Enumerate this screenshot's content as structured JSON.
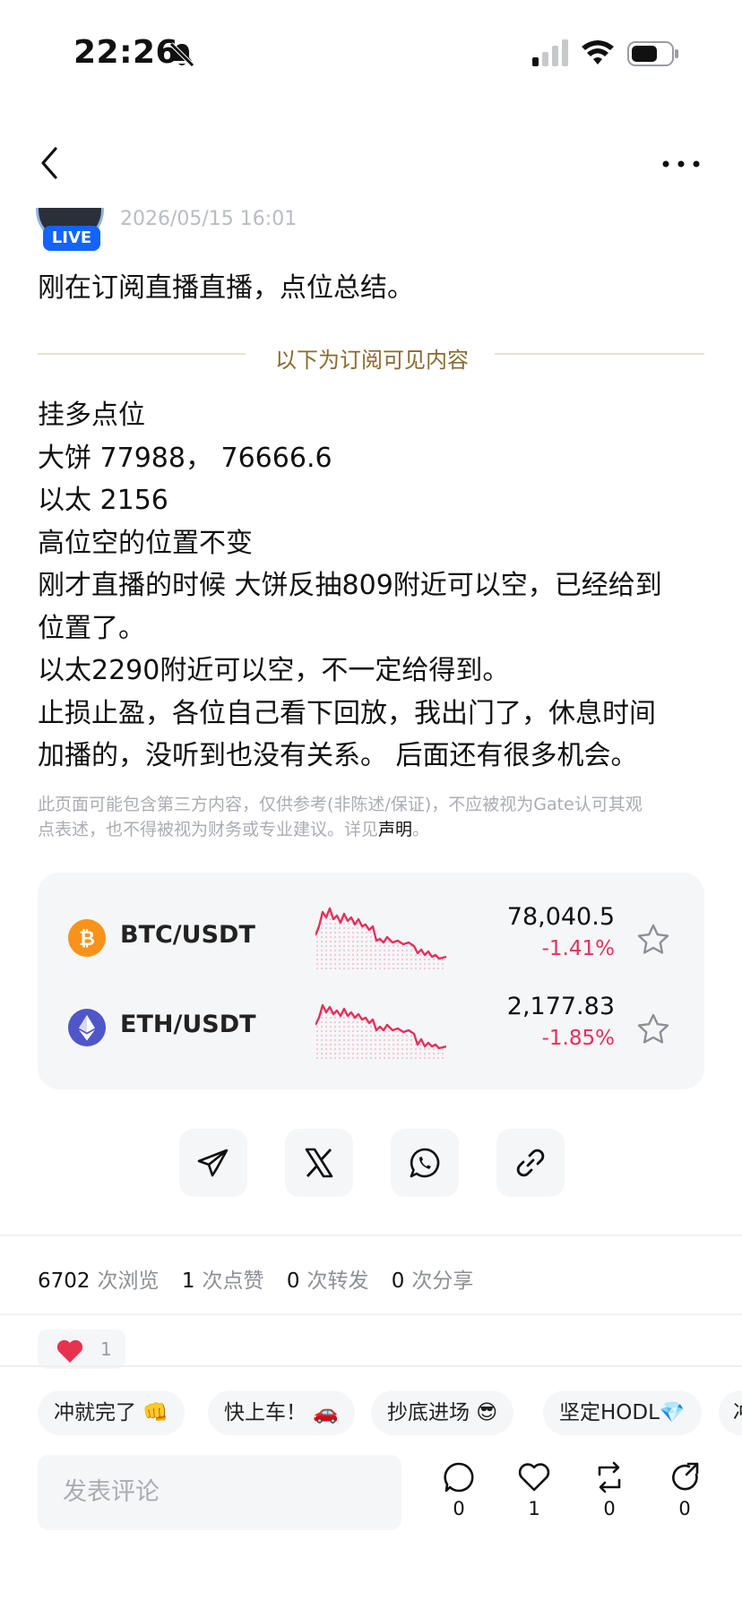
{
  "status_bar": {
    "time": "22:26"
  },
  "post": {
    "live_badge": "LIVE",
    "date": "2026/05/15 16:01",
    "title": "刚在订阅直播直播，点位总结。",
    "subscriber_divider": "以下为订阅可见内容",
    "body_lines": [
      "挂多点位",
      "大饼 77988，  76666.6",
      "以太 2156",
      "高位空的位置不变",
      "刚才直播的时候 大饼反抽809附近可以空，已经给到",
      "位置了。",
      "以太2290附近可以空，不一定给得到。",
      "止损止盈，各位自己看下回放，我出门了，休息时间",
      "加播的，没听到也没有关系。 后面还有很多机会。"
    ],
    "disclaimer_line1": "此页面可能包含第三方内容，仅供参考(非陈述/保证)，不应被视为Gate认可其观",
    "disclaimer_line2": "点表述，也不得被视为财务或专业建议。详见",
    "disclaimer_link": "声明",
    "disclaimer_end": "。"
  },
  "market": {
    "rows": [
      {
        "coin_icon": "bitcoin-icon",
        "pair": "BTC/USDT",
        "price": "78,040.5",
        "change": "-1.41%"
      },
      {
        "coin_icon": "ethereum-icon",
        "pair": "ETH/USDT",
        "price": "2,177.83",
        "change": "-1.85%"
      }
    ],
    "colors": {
      "down": "#e5305b",
      "btc": "#f7931a",
      "eth": "#4e56c9"
    }
  },
  "share_buttons": [
    "telegram-icon",
    "x-icon",
    "whatsapp-icon",
    "link-icon"
  ],
  "stats": {
    "views": "6702",
    "views_label": "次浏览",
    "likes": "1",
    "likes_label": "次点赞",
    "reposts": "0",
    "reposts_label": "次转发",
    "shares": "0",
    "shares_label": "次分享"
  },
  "reaction": {
    "emoji": "heart",
    "count": "1"
  },
  "quick_replies": [
    "冲就完了 👊",
    "快上车！ 🚗",
    "抄底进场 😎",
    "坚定HODL💎",
    "冲"
  ],
  "comment_bar": {
    "placeholder": "发表评论",
    "comment_count": "0",
    "like_count": "1",
    "repost_count": "0",
    "share_count": "0"
  }
}
